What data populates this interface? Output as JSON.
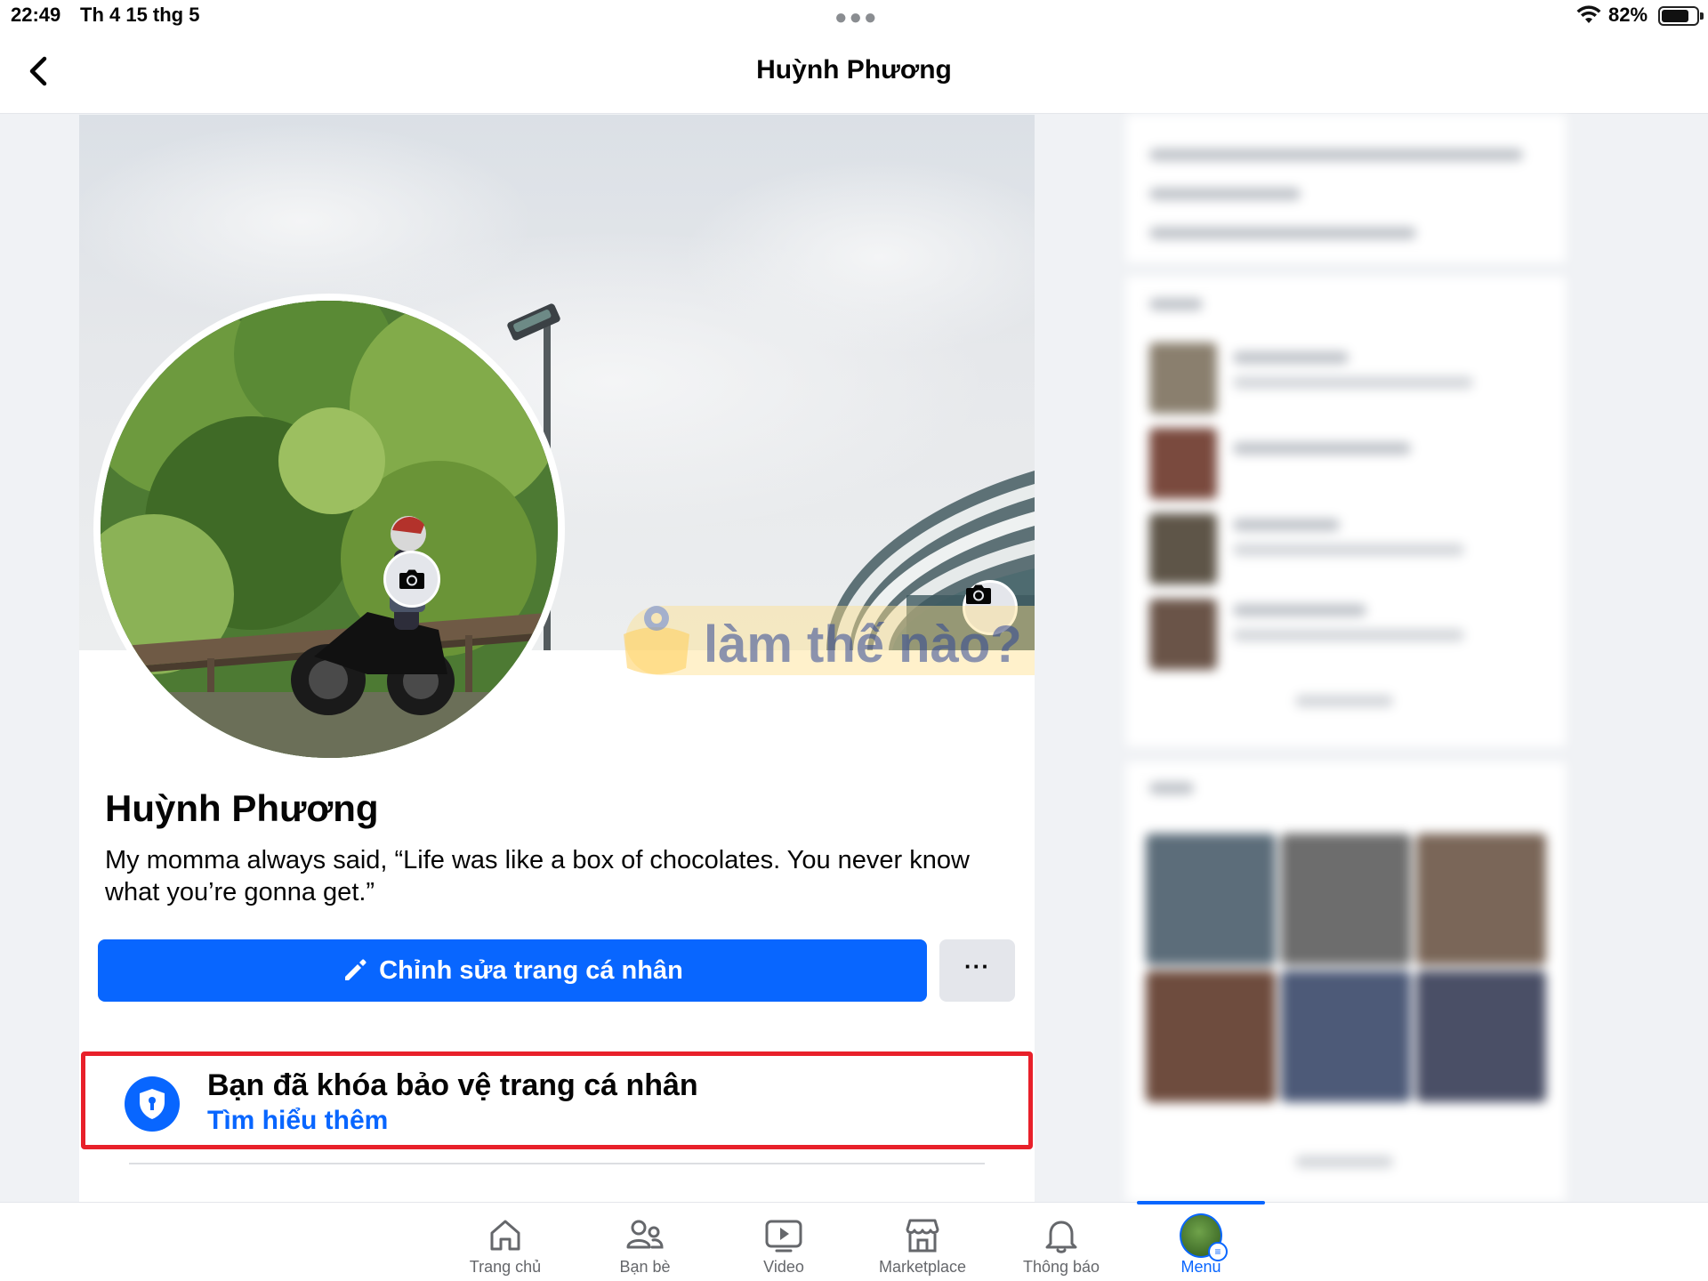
{
  "status_bar": {
    "time": "22:49",
    "date": "Th 4 15 thg 5",
    "battery": "82%"
  },
  "navbar": {
    "title": "Huỳnh Phương"
  },
  "profile": {
    "name": "Huỳnh Phương",
    "bio": "My momma always said, “Life was like a box of chocolates. You never know what you’re gonna get.”",
    "edit_button": "Chỉnh sửa trang cá nhân",
    "more_button": "···",
    "lock_notice": {
      "title": "Bạn đã khóa bảo vệ trang cá nhân",
      "link": "Tìm hiểu thêm"
    }
  },
  "watermark": {
    "text": "làm thế nào?"
  },
  "tabbar": {
    "items": [
      {
        "label": "Trang chủ",
        "icon": "home-icon"
      },
      {
        "label": "Bạn bè",
        "icon": "friends-icon"
      },
      {
        "label": "Video",
        "icon": "video-icon"
      },
      {
        "label": "Marketplace",
        "icon": "marketplace-icon"
      },
      {
        "label": "Thông báo",
        "icon": "bell-icon"
      },
      {
        "label": "Menu",
        "icon": "menu-avatar-icon",
        "active": true
      }
    ]
  },
  "colors": {
    "accent": "#0866ff",
    "highlight_border": "#e8202a",
    "background": "#f0f2f5"
  }
}
